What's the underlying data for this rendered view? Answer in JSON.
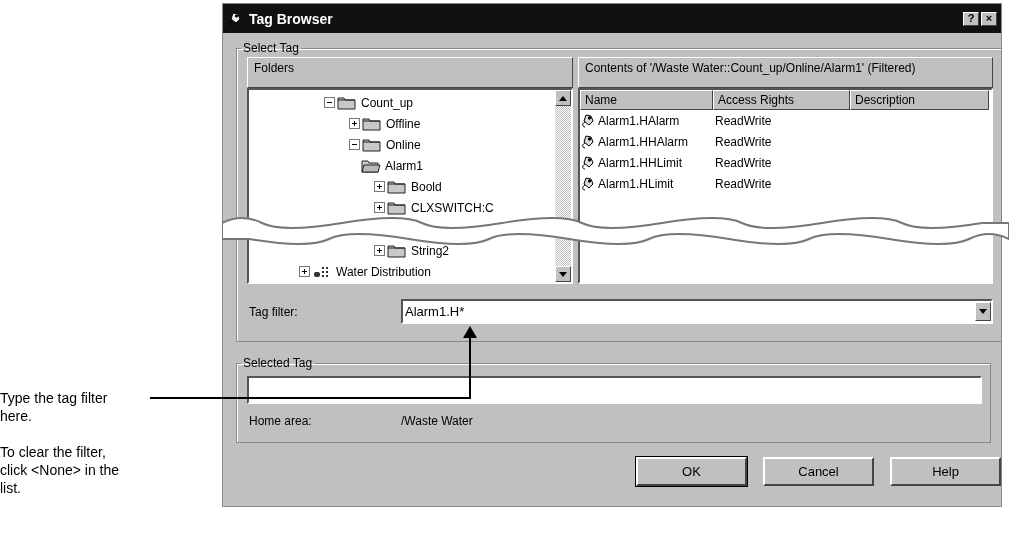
{
  "window": {
    "title": "Tag Browser",
    "help_button": "?",
    "close_button": "×"
  },
  "select_tag": {
    "title": "Select Tag",
    "folders_header": "Folders",
    "tree": [
      {
        "label": "Count_up",
        "kind": "folder",
        "has_children": true,
        "expanded": true,
        "selected": false,
        "children": [
          {
            "label": "Offline",
            "kind": "folder",
            "has_children": true,
            "expanded": false,
            "selected": false
          },
          {
            "label": "Online",
            "kind": "folder",
            "has_children": true,
            "expanded": true,
            "selected": false,
            "children": [
              {
                "label": "Alarm1",
                "kind": "folder",
                "has_children": false,
                "expanded": false,
                "selected": true
              },
              {
                "label": "Boold",
                "kind": "folder",
                "has_children": true,
                "expanded": false,
                "selected": false
              },
              {
                "label": "CLXSWITCH:C",
                "kind": "folder",
                "has_children": true,
                "expanded": false,
                "selected": false
              },
              {
                "label": "String2",
                "kind": "folder",
                "has_children": true,
                "expanded": false,
                "selected": false
              }
            ]
          }
        ]
      },
      {
        "label": "Water Distribution",
        "kind": "area",
        "has_children": true,
        "expanded": false,
        "selected": false
      }
    ],
    "contents_header": "Contents of '/Waste Water::Count_up/Online/Alarm1' (Filtered)",
    "columns": [
      "Name",
      "Access Rights",
      "Description"
    ],
    "rows": [
      {
        "name": "Alarm1.HAlarm",
        "access": "ReadWrite"
      },
      {
        "name": "Alarm1.HHAlarm",
        "access": "ReadWrite"
      },
      {
        "name": "Alarm1.HHLimit",
        "access": "ReadWrite"
      },
      {
        "name": "Alarm1.HLimit",
        "access": "ReadWrite"
      }
    ],
    "tag_filter": {
      "label": "Tag filter:",
      "value": "Alarm1.H*"
    }
  },
  "selected_tag": {
    "title": "Selected Tag",
    "home_area_label": "Home area:",
    "home_area": "/Waste Water"
  },
  "buttons": [
    {
      "label": "OK",
      "default": true
    },
    {
      "label": "Cancel",
      "default": false
    },
    {
      "label": "Help",
      "default": false
    }
  ],
  "callout": {
    "lines": [
      "Type the tag filter here.",
      "To clear the filter, click <None> in the list."
    ]
  }
}
